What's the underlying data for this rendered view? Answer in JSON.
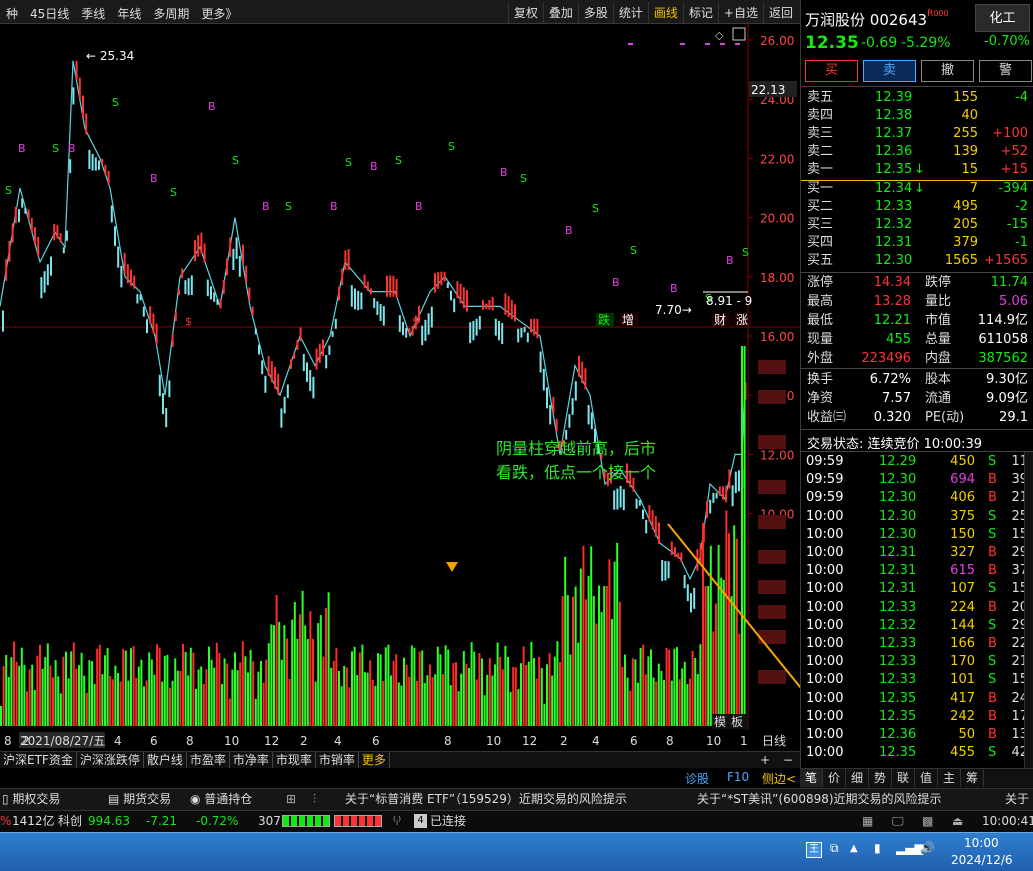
{
  "toolbar": {
    "left": [
      "种",
      "45日线",
      "季线",
      "年线",
      "多周期",
      "更多》"
    ],
    "right": [
      "复权",
      "叠加",
      "多股",
      "统计",
      "画线",
      "标记",
      "+自选",
      "返回"
    ],
    "active": "画线"
  },
  "stock": {
    "name": "万润股份",
    "code": "002643",
    "badge": "R",
    "badge2": "000",
    "sector": "化工",
    "sector_change": "-0.70%",
    "price": "12.35",
    "change": "-0.69",
    "pct": "-5.29%"
  },
  "actions": [
    "买",
    "卖",
    "撤",
    "警"
  ],
  "asks": [
    {
      "label": "卖五",
      "price": "12.39",
      "vol": "155",
      "chg": "-4"
    },
    {
      "label": "卖四",
      "price": "12.38",
      "vol": "40",
      "chg": ""
    },
    {
      "label": "卖三",
      "price": "12.37",
      "vol": "255",
      "chg": "+100"
    },
    {
      "label": "卖二",
      "price": "12.36",
      "vol": "139",
      "chg": "+52"
    },
    {
      "label": "卖一",
      "price": "12.35",
      "arrow": "↓",
      "vol": "15",
      "chg": "+15"
    }
  ],
  "bids": [
    {
      "label": "买一",
      "price": "12.34",
      "arrow": "↓",
      "vol": "7",
      "chg": "-394"
    },
    {
      "label": "买二",
      "price": "12.33",
      "vol": "495",
      "chg": "-2"
    },
    {
      "label": "买三",
      "price": "12.32",
      "vol": "205",
      "chg": "-15"
    },
    {
      "label": "买四",
      "price": "12.31",
      "vol": "379",
      "chg": "-1"
    },
    {
      "label": "买五",
      "price": "12.30",
      "vol": "1565",
      "chg": "+1565"
    }
  ],
  "stats": [
    [
      "涨停",
      "14.34",
      "跌停",
      "11.74"
    ],
    [
      "最高",
      "13.28",
      "量比",
      "5.06"
    ],
    [
      "最低",
      "12.21",
      "市值",
      "114.9亿"
    ],
    [
      "现量",
      "455",
      "总量",
      "611058"
    ],
    [
      "外盘",
      "223496",
      "内盘",
      "387562"
    ]
  ],
  "stats2": [
    [
      "换手",
      "6.72%",
      "股本",
      "9.30亿"
    ],
    [
      "净资",
      "7.57",
      "流通",
      "9.09亿"
    ],
    [
      "收益㈢",
      "0.320",
      "PE(动)",
      "29.1"
    ]
  ],
  "trade_status": "交易状态: 连续竞价 10:00:39",
  "ticks": [
    [
      "09:59",
      "12.29",
      "450",
      "S",
      "11"
    ],
    [
      "09:59",
      "12.30",
      "694",
      "B",
      "39"
    ],
    [
      "09:59",
      "12.30",
      "406",
      "B",
      "21"
    ],
    [
      "10:00",
      "12.30",
      "375",
      "S",
      "25"
    ],
    [
      "10:00",
      "12.30",
      "150",
      "S",
      "15"
    ],
    [
      "10:00",
      "12.31",
      "327",
      "B",
      "29"
    ],
    [
      "10:00",
      "12.31",
      "615",
      "B",
      "37"
    ],
    [
      "10:00",
      "12.31",
      "107",
      "S",
      "15"
    ],
    [
      "10:00",
      "12.33",
      "224",
      "B",
      "20"
    ],
    [
      "10:00",
      "12.32",
      "144",
      "S",
      "29"
    ],
    [
      "10:00",
      "12.33",
      "166",
      "B",
      "22"
    ],
    [
      "10:00",
      "12.33",
      "170",
      "S",
      "21"
    ],
    [
      "10:00",
      "12.33",
      "101",
      "S",
      "15"
    ],
    [
      "10:00",
      "12.35",
      "417",
      "B",
      "24"
    ],
    [
      "10:00",
      "12.35",
      "242",
      "B",
      "17"
    ],
    [
      "10:00",
      "12.36",
      "50",
      "B",
      "13"
    ],
    [
      "10:00",
      "12.35",
      "455",
      "S",
      "42"
    ]
  ],
  "right_tabs": [
    "笔",
    "价",
    "细",
    "势",
    "联",
    "值",
    "主",
    "筹"
  ],
  "chart": {
    "y_ticks": [
      "26.00",
      "24.00",
      "22.00",
      "20.00",
      "18.00",
      "16.00",
      "14.00",
      "12.00",
      "10.00"
    ],
    "current_tag": "22.13",
    "high_label": "25.34",
    "low_label": "7.70",
    "range_label": "8.91 - 9",
    "x_ticks": [
      "8",
      "2021/08/27/五",
      "2",
      "4",
      "6",
      "8",
      "10",
      "12",
      "2",
      "4",
      "6",
      "8",
      "10",
      "12",
      "2",
      "4",
      "6",
      "8",
      "10",
      "1"
    ],
    "x_tail": "日线",
    "markers": [
      "跌",
      "增",
      "财",
      "涨"
    ],
    "panel_btns": [
      "模",
      "板"
    ],
    "annotation": "阴量柱穿越前高，后市看跌，低点一个接一个",
    "annotation_line1": "阴量柱穿越前高，后市",
    "annotation_line2": "看跌，低点一个接一个"
  },
  "bottom_tabs": [
    "沪深ETF资金",
    "沪深涨跌停",
    "散户线",
    "市盈率",
    "市净率",
    "市现率",
    "市销率",
    "更多"
  ],
  "mid": {
    "diag": "诊股",
    "f10": "F10",
    "side": "侧边<"
  },
  "news": [
    "期权交易",
    "期货交易",
    "普通持仓",
    "关于“标普消费 ETF”（159529）近期交易的风险提示",
    "关于“*ST美讯”(600898)近期交易的风险提示",
    "关于"
  ],
  "status": {
    "amount": "1412亿",
    "kc": "科创",
    "kc_val": "994.63",
    "kc_chg": "-7.21",
    "kc_pct": "-0.72%",
    "kc_amt": "307.3亿",
    "conn_num": "4",
    "conn": "已连接",
    "time": "10:00:41"
  },
  "taskbar": {
    "time": "10:00",
    "date": "2024/12/6"
  },
  "colors": {
    "up": "#ff3333",
    "down": "#15e815",
    "accent": "#f2c200",
    "bg": "#000000"
  }
}
